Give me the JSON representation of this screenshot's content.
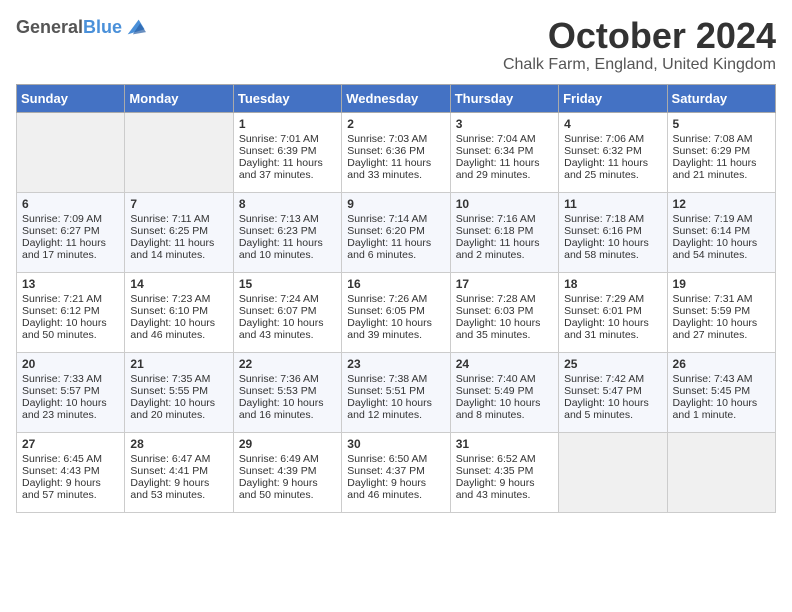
{
  "logo": {
    "general": "General",
    "blue": "Blue"
  },
  "header": {
    "month": "October 2024",
    "location": "Chalk Farm, England, United Kingdom"
  },
  "weekdays": [
    "Sunday",
    "Monday",
    "Tuesday",
    "Wednesday",
    "Thursday",
    "Friday",
    "Saturday"
  ],
  "weeks": [
    [
      {
        "day": "",
        "sunrise": "",
        "sunset": "",
        "daylight": ""
      },
      {
        "day": "",
        "sunrise": "",
        "sunset": "",
        "daylight": ""
      },
      {
        "day": "1",
        "sunrise": "Sunrise: 7:01 AM",
        "sunset": "Sunset: 6:39 PM",
        "daylight": "Daylight: 11 hours and 37 minutes."
      },
      {
        "day": "2",
        "sunrise": "Sunrise: 7:03 AM",
        "sunset": "Sunset: 6:36 PM",
        "daylight": "Daylight: 11 hours and 33 minutes."
      },
      {
        "day": "3",
        "sunrise": "Sunrise: 7:04 AM",
        "sunset": "Sunset: 6:34 PM",
        "daylight": "Daylight: 11 hours and 29 minutes."
      },
      {
        "day": "4",
        "sunrise": "Sunrise: 7:06 AM",
        "sunset": "Sunset: 6:32 PM",
        "daylight": "Daylight: 11 hours and 25 minutes."
      },
      {
        "day": "5",
        "sunrise": "Sunrise: 7:08 AM",
        "sunset": "Sunset: 6:29 PM",
        "daylight": "Daylight: 11 hours and 21 minutes."
      }
    ],
    [
      {
        "day": "6",
        "sunrise": "Sunrise: 7:09 AM",
        "sunset": "Sunset: 6:27 PM",
        "daylight": "Daylight: 11 hours and 17 minutes."
      },
      {
        "day": "7",
        "sunrise": "Sunrise: 7:11 AM",
        "sunset": "Sunset: 6:25 PM",
        "daylight": "Daylight: 11 hours and 14 minutes."
      },
      {
        "day": "8",
        "sunrise": "Sunrise: 7:13 AM",
        "sunset": "Sunset: 6:23 PM",
        "daylight": "Daylight: 11 hours and 10 minutes."
      },
      {
        "day": "9",
        "sunrise": "Sunrise: 7:14 AM",
        "sunset": "Sunset: 6:20 PM",
        "daylight": "Daylight: 11 hours and 6 minutes."
      },
      {
        "day": "10",
        "sunrise": "Sunrise: 7:16 AM",
        "sunset": "Sunset: 6:18 PM",
        "daylight": "Daylight: 11 hours and 2 minutes."
      },
      {
        "day": "11",
        "sunrise": "Sunrise: 7:18 AM",
        "sunset": "Sunset: 6:16 PM",
        "daylight": "Daylight: 10 hours and 58 minutes."
      },
      {
        "day": "12",
        "sunrise": "Sunrise: 7:19 AM",
        "sunset": "Sunset: 6:14 PM",
        "daylight": "Daylight: 10 hours and 54 minutes."
      }
    ],
    [
      {
        "day": "13",
        "sunrise": "Sunrise: 7:21 AM",
        "sunset": "Sunset: 6:12 PM",
        "daylight": "Daylight: 10 hours and 50 minutes."
      },
      {
        "day": "14",
        "sunrise": "Sunrise: 7:23 AM",
        "sunset": "Sunset: 6:10 PM",
        "daylight": "Daylight: 10 hours and 46 minutes."
      },
      {
        "day": "15",
        "sunrise": "Sunrise: 7:24 AM",
        "sunset": "Sunset: 6:07 PM",
        "daylight": "Daylight: 10 hours and 43 minutes."
      },
      {
        "day": "16",
        "sunrise": "Sunrise: 7:26 AM",
        "sunset": "Sunset: 6:05 PM",
        "daylight": "Daylight: 10 hours and 39 minutes."
      },
      {
        "day": "17",
        "sunrise": "Sunrise: 7:28 AM",
        "sunset": "Sunset: 6:03 PM",
        "daylight": "Daylight: 10 hours and 35 minutes."
      },
      {
        "day": "18",
        "sunrise": "Sunrise: 7:29 AM",
        "sunset": "Sunset: 6:01 PM",
        "daylight": "Daylight: 10 hours and 31 minutes."
      },
      {
        "day": "19",
        "sunrise": "Sunrise: 7:31 AM",
        "sunset": "Sunset: 5:59 PM",
        "daylight": "Daylight: 10 hours and 27 minutes."
      }
    ],
    [
      {
        "day": "20",
        "sunrise": "Sunrise: 7:33 AM",
        "sunset": "Sunset: 5:57 PM",
        "daylight": "Daylight: 10 hours and 23 minutes."
      },
      {
        "day": "21",
        "sunrise": "Sunrise: 7:35 AM",
        "sunset": "Sunset: 5:55 PM",
        "daylight": "Daylight: 10 hours and 20 minutes."
      },
      {
        "day": "22",
        "sunrise": "Sunrise: 7:36 AM",
        "sunset": "Sunset: 5:53 PM",
        "daylight": "Daylight: 10 hours and 16 minutes."
      },
      {
        "day": "23",
        "sunrise": "Sunrise: 7:38 AM",
        "sunset": "Sunset: 5:51 PM",
        "daylight": "Daylight: 10 hours and 12 minutes."
      },
      {
        "day": "24",
        "sunrise": "Sunrise: 7:40 AM",
        "sunset": "Sunset: 5:49 PM",
        "daylight": "Daylight: 10 hours and 8 minutes."
      },
      {
        "day": "25",
        "sunrise": "Sunrise: 7:42 AM",
        "sunset": "Sunset: 5:47 PM",
        "daylight": "Daylight: 10 hours and 5 minutes."
      },
      {
        "day": "26",
        "sunrise": "Sunrise: 7:43 AM",
        "sunset": "Sunset: 5:45 PM",
        "daylight": "Daylight: 10 hours and 1 minute."
      }
    ],
    [
      {
        "day": "27",
        "sunrise": "Sunrise: 6:45 AM",
        "sunset": "Sunset: 4:43 PM",
        "daylight": "Daylight: 9 hours and 57 minutes."
      },
      {
        "day": "28",
        "sunrise": "Sunrise: 6:47 AM",
        "sunset": "Sunset: 4:41 PM",
        "daylight": "Daylight: 9 hours and 53 minutes."
      },
      {
        "day": "29",
        "sunrise": "Sunrise: 6:49 AM",
        "sunset": "Sunset: 4:39 PM",
        "daylight": "Daylight: 9 hours and 50 minutes."
      },
      {
        "day": "30",
        "sunrise": "Sunrise: 6:50 AM",
        "sunset": "Sunset: 4:37 PM",
        "daylight": "Daylight: 9 hours and 46 minutes."
      },
      {
        "day": "31",
        "sunrise": "Sunrise: 6:52 AM",
        "sunset": "Sunset: 4:35 PM",
        "daylight": "Daylight: 9 hours and 43 minutes."
      },
      {
        "day": "",
        "sunrise": "",
        "sunset": "",
        "daylight": ""
      },
      {
        "day": "",
        "sunrise": "",
        "sunset": "",
        "daylight": ""
      }
    ]
  ]
}
